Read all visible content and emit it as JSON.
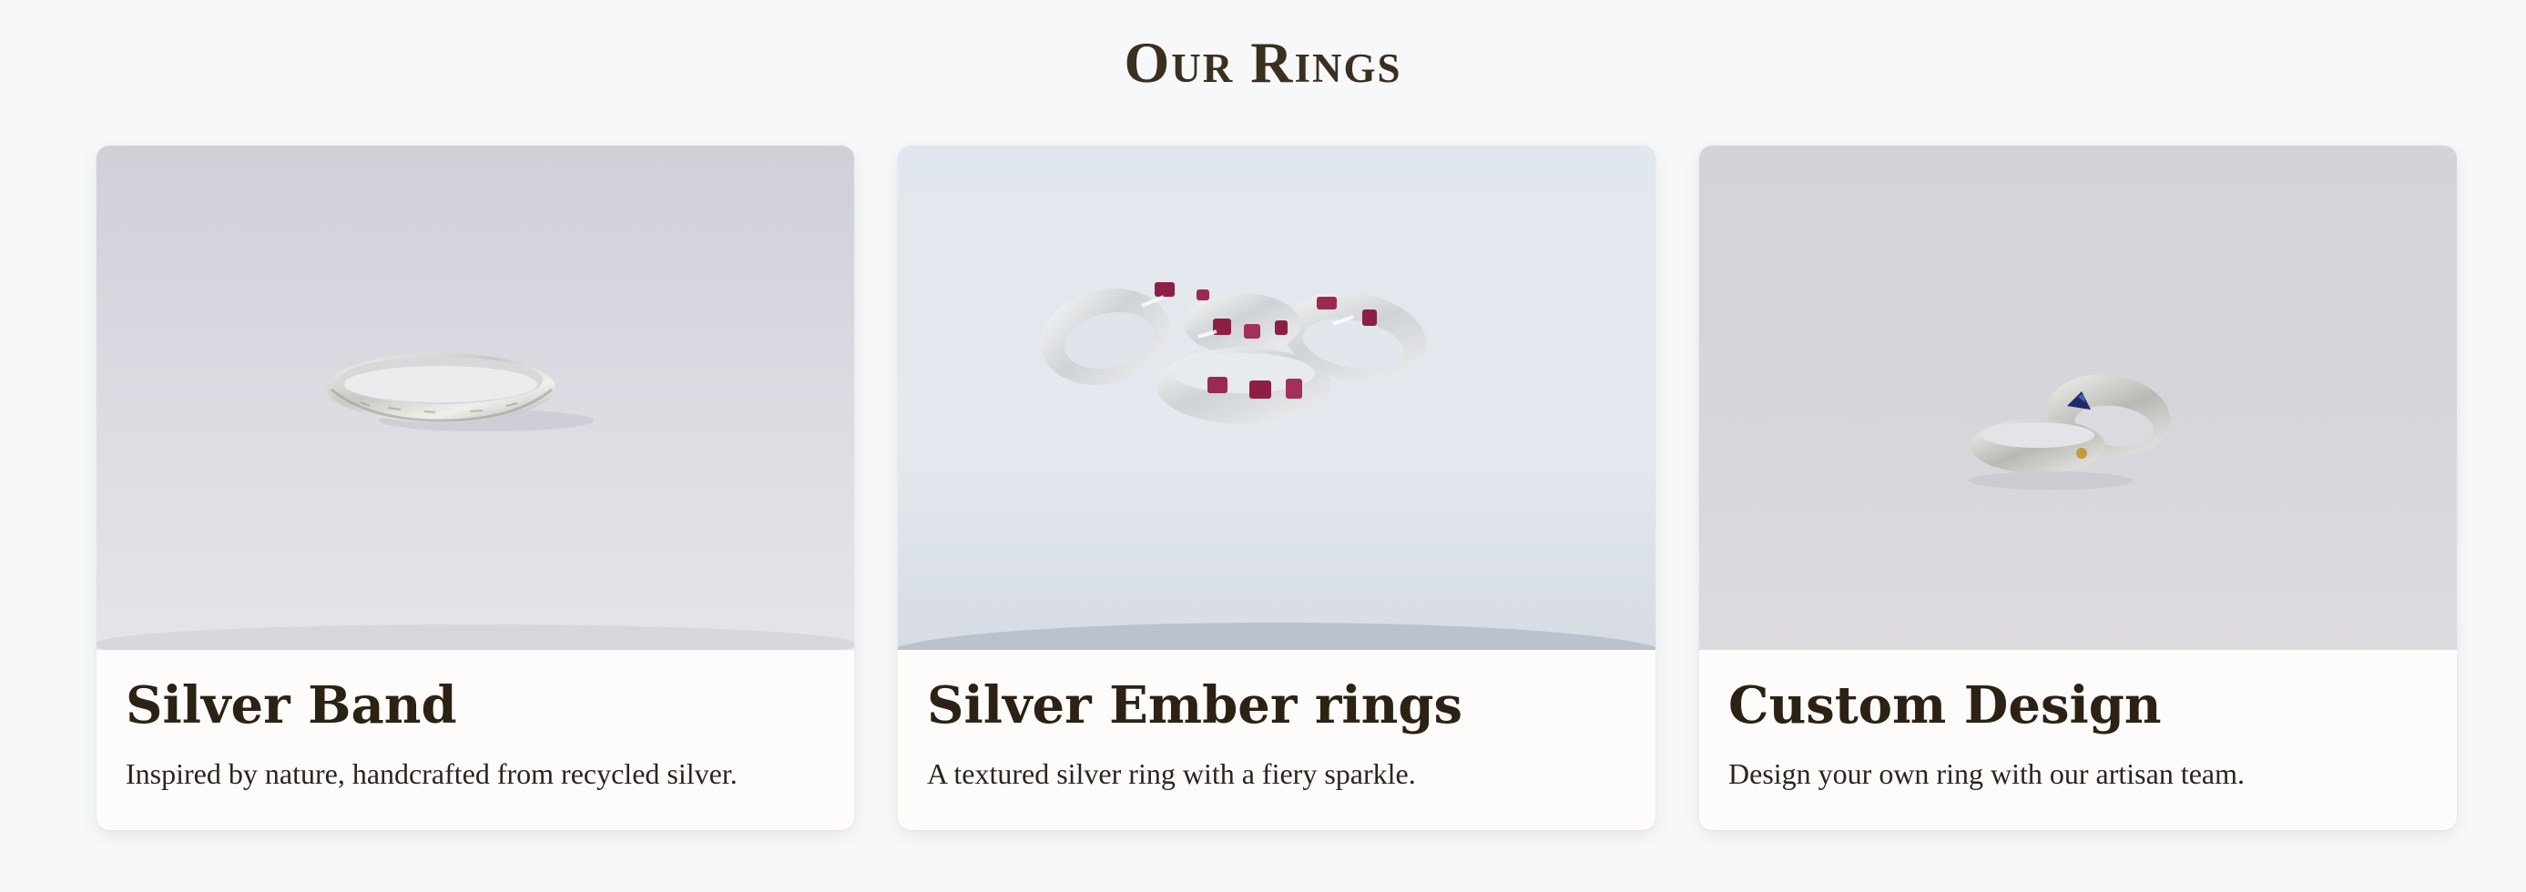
{
  "section": {
    "title": "Our Rings"
  },
  "cards": [
    {
      "title": "Silver Band",
      "description": "Inspired by nature, handcrafted from recycled silver."
    },
    {
      "title": "Silver Ember rings",
      "description": "A textured silver ring with a fiery sparkle."
    },
    {
      "title": "Custom Design",
      "description": "Design your own ring with our artisan team."
    }
  ],
  "colors": {
    "page_background": "#f7f8f9",
    "heading": "#3b2f1f",
    "card_background": "#fdfcfa",
    "ruby_accent": "#8e1f44",
    "sapphire_accent": "#1d2a6b"
  }
}
